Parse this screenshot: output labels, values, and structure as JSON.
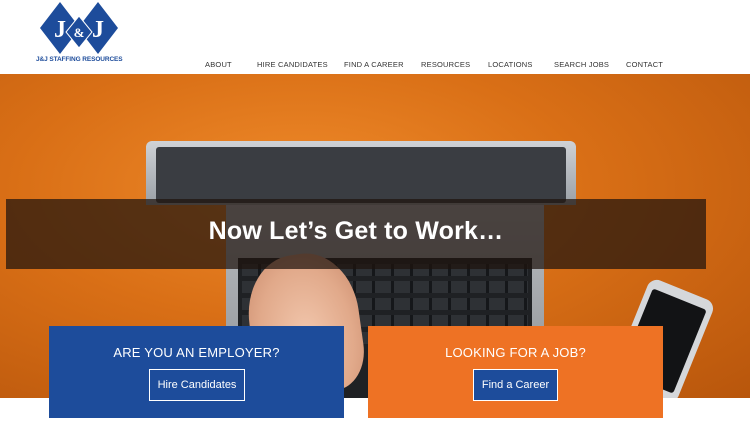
{
  "brand": {
    "logo_letters": "J&J",
    "name": "J&J STAFFING RESOURCES",
    "logo_color": "#1d4c9b"
  },
  "nav": {
    "items": [
      "ABOUT",
      "HIRE CANDIDATES",
      "FIND A CAREER",
      "RESOURCES",
      "LOCATIONS",
      "SEARCH JOBS",
      "CONTACT"
    ]
  },
  "hero": {
    "headline": "Now Let’s Get to Work…"
  },
  "employer_card": {
    "title": "ARE YOU AN EMPLOYER?",
    "button_label": "Hire Candidates",
    "color": "#1d4c9b"
  },
  "job_card": {
    "title": "LOOKING FOR A JOB?",
    "button_label": "Find a Career",
    "color": "#ee7224"
  }
}
